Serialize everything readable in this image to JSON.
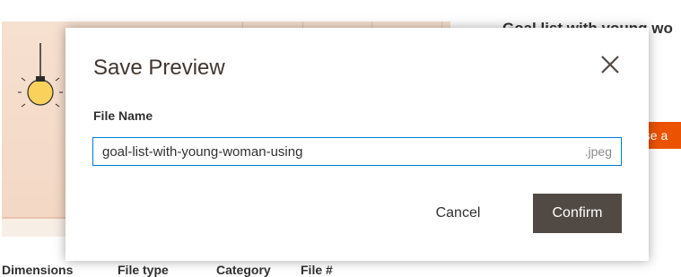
{
  "background": {
    "title": "Goal list with young wo",
    "orange_button_text": "nse a",
    "meta_labels": [
      "Dimensions",
      "File type",
      "Category",
      "File #"
    ]
  },
  "modal": {
    "title": "Save Preview",
    "close_icon": "close-icon",
    "field_label": "File Name",
    "file_name_value": "goal-list-with-young-woman-using",
    "file_extension": ".jpeg",
    "cancel_label": "Cancel",
    "confirm_label": "Confirm"
  },
  "colors": {
    "confirm_bg": "#514943",
    "input_border": "#007bdb",
    "orange_accent": "#eb5202"
  }
}
